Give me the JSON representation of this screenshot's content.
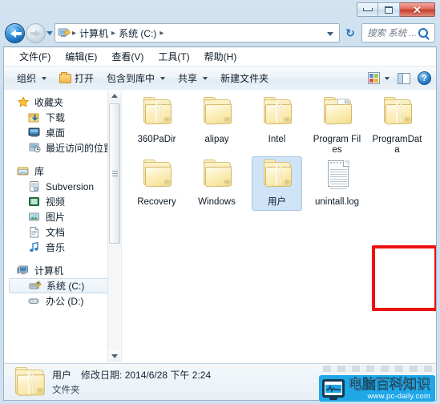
{
  "window": {
    "controls": {
      "minimize": "–",
      "maximize": "□",
      "close": "✕"
    }
  },
  "addressbar": {
    "back_tooltip": "后退",
    "forward_tooltip": "前进",
    "crumbs": [
      "计算机",
      "系统 (C:)"
    ],
    "separator": "▸",
    "refresh_glyph": "↻",
    "search_placeholder": "搜索 系统 ..."
  },
  "menubar": {
    "items": [
      "文件(F)",
      "编辑(E)",
      "查看(V)",
      "工具(T)",
      "帮助(H)"
    ]
  },
  "toolbar": {
    "organize": "组织",
    "open": "打开",
    "include_in_library": "包含到库中",
    "share": "共享",
    "new_folder": "新建文件夹",
    "help_glyph": "?"
  },
  "navpane": {
    "groups": [
      {
        "header": {
          "label": "收藏夹",
          "icon": "star-icon"
        },
        "items": [
          {
            "label": "下载",
            "icon": "downloads-icon"
          },
          {
            "label": "桌面",
            "icon": "desktop-icon"
          },
          {
            "label": "最近访问的位置",
            "icon": "recent-places-icon"
          }
        ]
      },
      {
        "header": {
          "label": "库",
          "icon": "library-icon"
        },
        "items": [
          {
            "label": "Subversion",
            "icon": "subversion-icon"
          },
          {
            "label": "视频",
            "icon": "video-icon"
          },
          {
            "label": "图片",
            "icon": "pictures-icon"
          },
          {
            "label": "文档",
            "icon": "documents-icon"
          },
          {
            "label": "音乐",
            "icon": "music-icon"
          }
        ]
      },
      {
        "header": {
          "label": "计算机",
          "icon": "computer-icon"
        },
        "items": [
          {
            "label": "系统 (C:)",
            "icon": "system-drive-icon",
            "selected": true
          },
          {
            "label": "办公 (D:)",
            "icon": "drive-icon",
            "selected": false
          }
        ]
      }
    ]
  },
  "content": {
    "items": [
      {
        "name": "360PaDir",
        "type": "folder",
        "selected": false
      },
      {
        "name": "alipay",
        "type": "folder",
        "selected": false
      },
      {
        "name": "Intel",
        "type": "folder",
        "selected": false
      },
      {
        "name": "Program Files",
        "type": "folder-file",
        "selected": false
      },
      {
        "name": "ProgramData",
        "type": "folder",
        "selected": false
      },
      {
        "name": "Recovery",
        "type": "folder",
        "selected": false
      },
      {
        "name": "Windows",
        "type": "folder",
        "selected": false
      },
      {
        "name": "用户",
        "type": "folder",
        "selected": true
      },
      {
        "name": "unintall.log",
        "type": "logfile",
        "selected": false
      }
    ]
  },
  "details": {
    "name": "用户",
    "modified_label": "修改日期:",
    "modified_value": "2014/6/28 下午 2:24",
    "type": "文件夹"
  },
  "watermark": {
    "title": "电脑百科知识",
    "url": "www.pc-daily.com"
  },
  "colors": {
    "selection": "#cfe4f7",
    "highlight_box": "#ee1111",
    "accent": "#1fa7e8",
    "folder": "#f7e49c"
  }
}
